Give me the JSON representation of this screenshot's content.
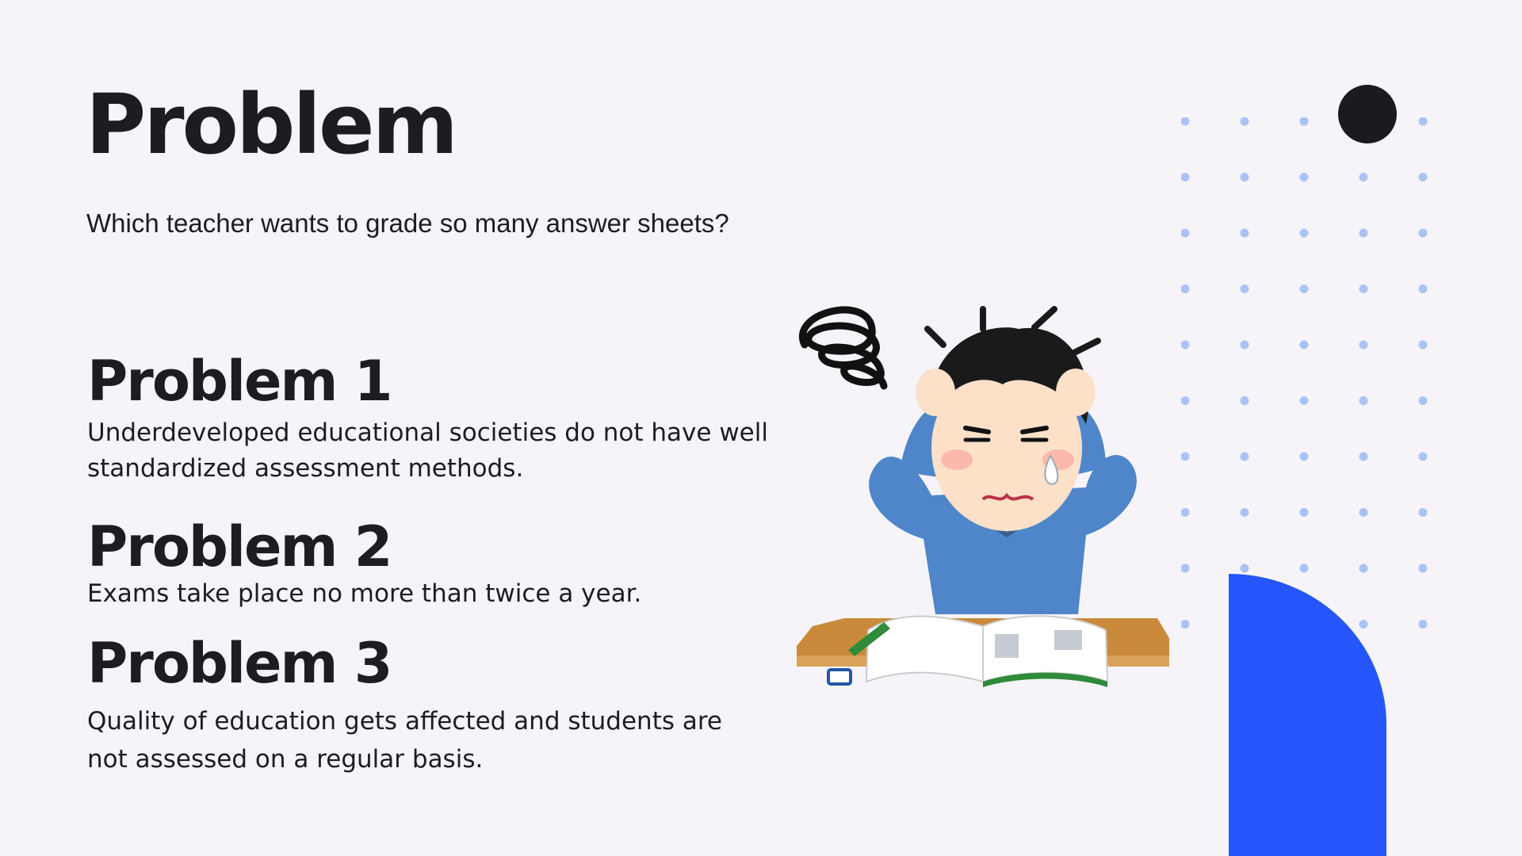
{
  "slide": {
    "title": "Problem",
    "subtitle": "Which teacher wants to grade so many answer sheets?",
    "problems": [
      {
        "heading": "Problem 1",
        "text": "Underdeveloped educational societies do not have well standardized assessment methods."
      },
      {
        "heading": "Problem 2",
        "text": "Exams take place no more than twice a year."
      },
      {
        "heading": "Problem 3",
        "text": "Quality of education gets affected and students are not assessed on a regular basis."
      }
    ]
  },
  "decor": {
    "illustration_icon": "stressed-student-at-desk-icon",
    "dot_color": "#a9c3f5",
    "accent_blue": "#2456fb",
    "black_dot_color": "#1a1a20"
  }
}
